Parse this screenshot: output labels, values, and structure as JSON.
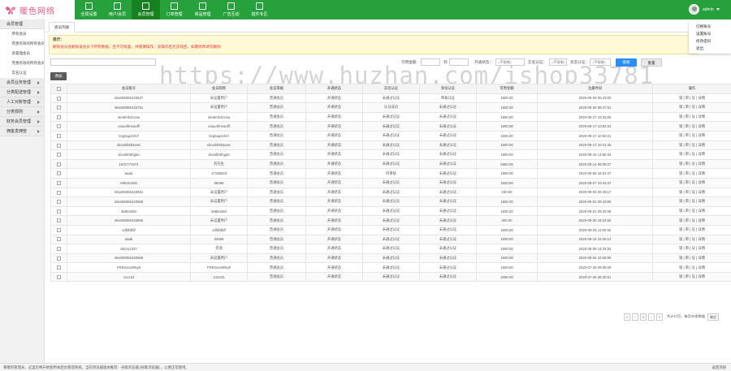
{
  "brand": {
    "name": "暖色网络"
  },
  "nav": [
    {
      "label": "全局设置",
      "active": false
    },
    {
      "label": "用户/会员",
      "active": false
    },
    {
      "label": "会员管理",
      "active": true
    },
    {
      "label": "订单管理",
      "active": false
    },
    {
      "label": "商品管理",
      "active": false
    },
    {
      "label": "广告互动",
      "active": false
    },
    {
      "label": "插件专区",
      "active": false
    }
  ],
  "user": {
    "name": "admin",
    "menu": [
      "切换账号",
      "设置账号",
      "修改密码",
      "退出"
    ]
  },
  "sidebar": {
    "groups": [
      {
        "label": "会员管理",
        "subs": [
          "所有会员",
          "完善有效的所有会员",
          "高管理会员",
          "完善有效的所有会员",
          "实名认证"
        ]
      },
      {
        "label": "会员业务管理",
        "subs": []
      },
      {
        "label": "分类配送管理",
        "subs": []
      },
      {
        "label": "人工对账管理",
        "subs": []
      },
      {
        "label": "分类规则",
        "subs": []
      },
      {
        "label": "财务会员管理",
        "subs": []
      },
      {
        "label": "佣金发佣管",
        "subs": []
      }
    ]
  },
  "tabs": {
    "active": "会员列表"
  },
  "notice": {
    "title": "提示：",
    "body": "删除会员会删除该会员下所有数据，且不可恢复，并谨慎操作，该操作后无法找回。如需修改请勿删除"
  },
  "filter": {
    "date_label": "可用金额：",
    "date_sep": "到",
    "sel1_label": "开通状态：",
    "sel1_value": "=不限制=",
    "sel2_label": "实名认证：",
    "sel2_value": "=不限制=",
    "sel3_label": "状态认证：",
    "sel3_value": "=不限制=",
    "search_btn": "搜索",
    "reset_btn": "重置"
  },
  "add_btn": "添加",
  "watermark": "https://www.huzhan.com/ishop33781",
  "table": {
    "headers": [
      "会员账号",
      "会员昵称",
      "会员等级",
      "开通状态",
      "实名认证",
      "身份认证",
      "可用金额",
      "注册时间",
      "操作"
    ],
    "rows": [
      [
        "mlan06065433637",
        "未设置用户",
        "普通会员",
        "开通状态",
        "未通过认证",
        "审核认证",
        "1600.00",
        "2020-09-30 05:43:00",
        ""
      ],
      [
        "mlan06065433751",
        "未设置用户",
        "普通会员",
        "开通状态",
        "认证成功",
        "未通过认证",
        "1600.00",
        "2020-09-20 08:47:51",
        "red"
      ],
      [
        "ntiu5mh41nau",
        "ntiu5mh41nau",
        "普通会员",
        "开通状态",
        "未通过认证",
        "未通过认证",
        "1600.00",
        "2020-09-17 10:33:25",
        ""
      ],
      [
        "cauu4hnvuulff",
        "cauu4hnvuulff",
        "普通会员",
        "开通状态",
        "未通过认证",
        "未通过认证",
        "1600.00",
        "2020-09-17 10:52:24",
        ""
      ],
      [
        "bcg5ug4chcf",
        "bcg5ug4chcf",
        "普通会员",
        "开通状态",
        "未通过认证",
        "未通过认证",
        "1600.00",
        "2020-09-17 10:50:21",
        ""
      ],
      [
        "xbcwbh5b4wec",
        "xbcwbh5b4wec",
        "普通会员",
        "开通状态",
        "未通过认证",
        "未通过认证",
        "1600.00",
        "2020-09-17 10:41:45",
        ""
      ],
      [
        "xbcwbh5hgdo",
        "xbcwbh5hgdo",
        "普通会员",
        "开通状态",
        "未通过认证",
        "未通过认证",
        "1600.00",
        "2020-09-16 14:56:34",
        ""
      ],
      [
        "1001771974",
        "刘先生",
        "普通会员",
        "开通状态",
        "未通过认证",
        "未通过认证",
        "5660.00",
        "2020-09-14 08:08:27",
        ""
      ],
      [
        "aaaa",
        "17195533",
        "普通会员",
        "开通状态",
        "待审核",
        "未通过认证",
        "1600.00",
        "2020-09-08 16:03:47",
        "orange"
      ],
      [
        "A85151531",
        "56365",
        "普通会员",
        "开通状态",
        "未通过认证",
        "未通过认证",
        "1600.00",
        "2020-09-07 10:43:37",
        ""
      ],
      [
        "mlan06065433651",
        "未设置用户",
        "普通会员",
        "开通状态",
        "未通过认证",
        "未通过认证",
        "160.00",
        "2020-09-02 09:49:17",
        ""
      ],
      [
        "mlan06065433659",
        "未设置用户",
        "普通会员",
        "开通状态",
        "未通过认证",
        "未通过认证",
        "1600.00",
        "2020-09-01 09:43:05",
        ""
      ],
      [
        "45844484",
        "45844484",
        "普通会员",
        "开通状态",
        "未通过认证",
        "未通过认证",
        "1600.00",
        "2020-09-01 09:32:08",
        ""
      ],
      [
        "mlan06065433665",
        "未设置用户",
        "普通会员",
        "开通状态",
        "未通过认证",
        "未通过认证",
        "300.00",
        "2020-08-30 18:24:50",
        ""
      ],
      [
        "xdfdfdfdf",
        "xdfdfdfdf",
        "普通会员",
        "开通状态",
        "未通过认证",
        "未通过认证",
        "1600.00",
        "2020-08-25 11:00:50",
        ""
      ],
      [
        "aaab",
        "32656",
        "普通会员",
        "开通状态",
        "未通过认证",
        "未通过认证",
        "1600.00",
        "2020-08-15 16:25:14",
        ""
      ],
      [
        "abcxyz327",
        "李逍",
        "普通会员",
        "开通状态",
        "未通过认证",
        "未通过认证",
        "1600.00",
        "2020-08-08 14:33:34",
        ""
      ],
      [
        "mlan06065433668",
        "未设置用户",
        "普通会员",
        "开通状态",
        "未通过认证",
        "未通过认证",
        "1600.00",
        "2020-08-04 22:08:50",
        ""
      ],
      [
        "FRE0xxx8h5y5",
        "FRE0xxx8h5y5",
        "普通会员",
        "开通状态",
        "未通过认证",
        "未通过认证",
        "1600.00",
        "2020-07-29 09:08:28",
        ""
      ],
      [
        "cccz10",
        "211231",
        "普通会员",
        "开通状态",
        "未通过认证",
        "未通过认证",
        "2000.00",
        "2020-07-25 09:30:41",
        ""
      ]
    ],
    "ops": [
      "锁",
      "审",
      "证",
      "详情"
    ]
  },
  "pager": {
    "current": "1",
    "info": "共计17页，每页20条数据",
    "go": "确定"
  },
  "footer": {
    "left": "尊敬的管理员，这里您将开始使用本后台管理系统，当前浏览器版本推荐：谷歌浏览器 [谷歌浏览器] ，以便正常使用。",
    "right": "返回顶部"
  }
}
